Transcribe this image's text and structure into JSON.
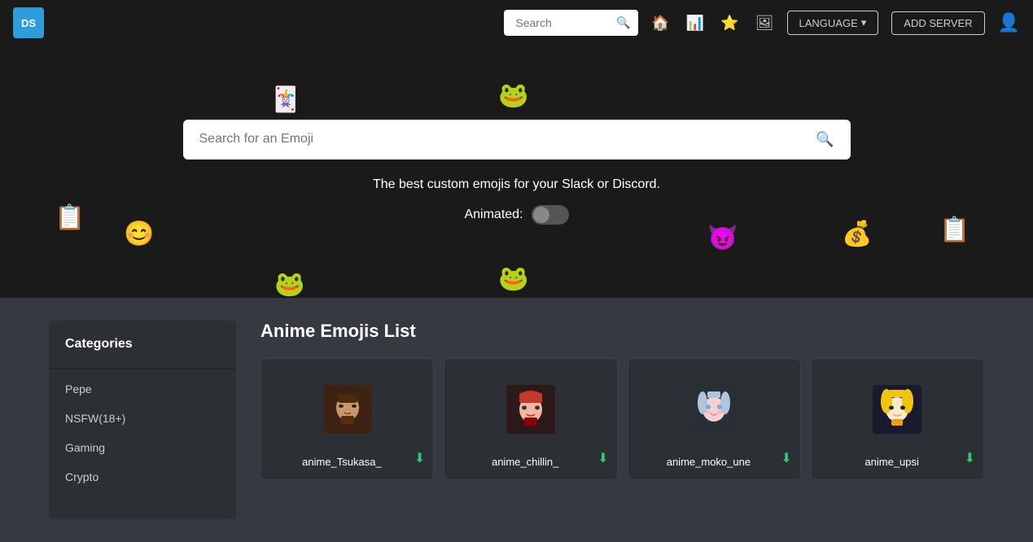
{
  "navbar": {
    "logo": "DS",
    "search": {
      "placeholder": "Search",
      "value": ""
    },
    "icons": {
      "home": "🏠",
      "bar": "📊",
      "star": "⭐",
      "image": "🖼"
    },
    "language_label": "LANGUAGE",
    "add_server_label": "ADD SERVER"
  },
  "hero": {
    "search_placeholder": "Search for an Emoji",
    "tagline": "The best custom emojis for your Slack or Discord.",
    "animated_label": "Animated:",
    "toggle_on": false,
    "floating_emojis": [
      "🃏",
      "🐸",
      "📋",
      "😊",
      "😈",
      "💰",
      "📋",
      "🐸",
      "🐸"
    ]
  },
  "sidebar": {
    "title": "Categories",
    "items": [
      {
        "label": "Pepe",
        "active": false
      },
      {
        "label": "NSFW(18+)",
        "active": false
      },
      {
        "label": "Gaming",
        "active": false
      },
      {
        "label": "Crypto",
        "active": false
      }
    ]
  },
  "emoji_list": {
    "title": "Anime Emojis List",
    "emojis": [
      {
        "name": "anime_Tsukasa_",
        "type": "tsukasa"
      },
      {
        "name": "anime_chillin_",
        "type": "chillin"
      },
      {
        "name": "anime_moko_une",
        "type": "moko"
      },
      {
        "name": "anime_upsi",
        "type": "upsi"
      }
    ]
  }
}
